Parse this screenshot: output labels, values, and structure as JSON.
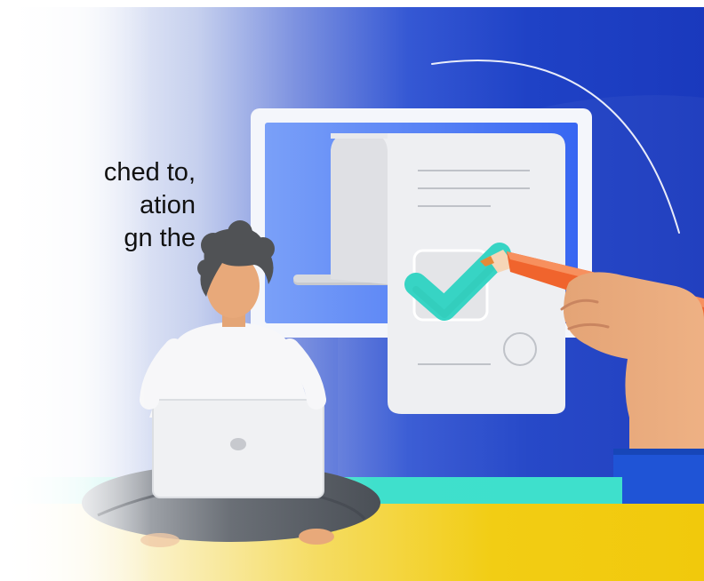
{
  "illustration": {
    "subject": "person-with-laptop-and-hand-signing-document",
    "colors": {
      "background_blue": "#1e40c8",
      "monitor_frame": "#f4f6fb",
      "screen_blue": "#3b6cf4",
      "document": "#eeeff2",
      "checkmark": "#37d4c4",
      "pen_orange": "#f0642d",
      "skin": "#e8a97a",
      "floor_yellow": "#f2cc0f",
      "teal_stripe": "#3ee0cc",
      "sleeve_blue": "#1f54d6",
      "hair": "#505255"
    }
  },
  "text": {
    "lines": [
      "ched to,",
      "ation",
      "gn the"
    ]
  }
}
